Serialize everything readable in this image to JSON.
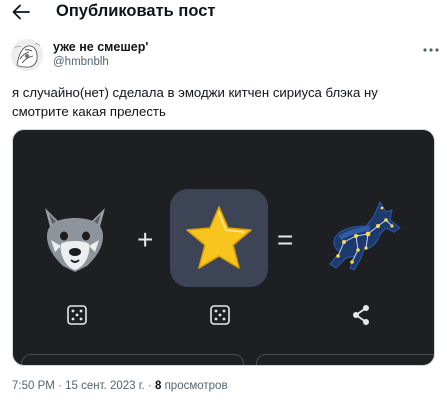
{
  "header": {
    "title": "Опубликовать пост",
    "back_icon": "arrow-left-icon"
  },
  "author": {
    "name": "уже не смешер'",
    "handle": "@hmbnblh",
    "more_icon": "more-horizontal-icon"
  },
  "post": {
    "text": "я случайно(нет) сделала в эмоджи китчен сириуса блэка ну смотрите какая прелесть"
  },
  "media": {
    "left_emoji": "wolf-emoji",
    "plus": "+",
    "middle_emoji": "star-emoji",
    "equals": "=",
    "result": "constellation-wolf-sticker",
    "icons": [
      "dice-icon",
      "dice-icon",
      "share-icon"
    ]
  },
  "meta": {
    "time": "7:50 PM",
    "sep1": "·",
    "date": "15 сент. 2023 г.",
    "sep2": "·",
    "views_count": "8",
    "views_label": "просмотров"
  },
  "colors": {
    "text": "#0f1419",
    "muted": "#536471",
    "media_bg": "#1e1f22",
    "tile_bg": "#3c4456",
    "star": "#f7c51e"
  }
}
